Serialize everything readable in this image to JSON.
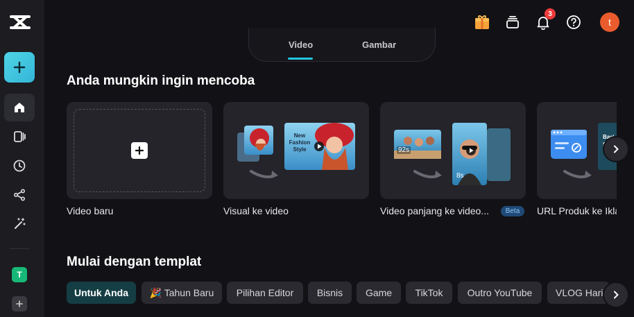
{
  "tabs": [
    {
      "label": "Video"
    },
    {
      "label": "Gambar"
    }
  ],
  "notifications": {
    "count": "3"
  },
  "user": {
    "initial": "t"
  },
  "workspace": {
    "initial": "T"
  },
  "section1": {
    "title": "Anda mungkin ingin mencoba",
    "cards": [
      {
        "label": "Video baru"
      },
      {
        "label": "Visual ke video",
        "thumb_text": "New Fashion Style"
      },
      {
        "label": "Video panjang ke video...",
        "badge": "Beta",
        "duration_long": "92s",
        "duration_short": "8s"
      },
      {
        "label": "URL Produk ke Ikla",
        "thumb_text": "Back S"
      }
    ]
  },
  "section2": {
    "title": "Mulai dengan templat",
    "chips": [
      {
        "label": "Untuk Anda",
        "active": true
      },
      {
        "label": "🎉 Tahun Baru"
      },
      {
        "label": "Pilihan Editor"
      },
      {
        "label": "Bisnis"
      },
      {
        "label": "Game"
      },
      {
        "label": "TikTok"
      },
      {
        "label": "Outro YouTube"
      },
      {
        "label": "VLOG Hari"
      }
    ]
  },
  "colors": {
    "accent": "#22c7df",
    "create_button": "#4fd4e6",
    "badge": "#ef3b3b",
    "avatar": "#ea5b2d",
    "workspace": "#17b877",
    "chip_active": "#153e44"
  }
}
